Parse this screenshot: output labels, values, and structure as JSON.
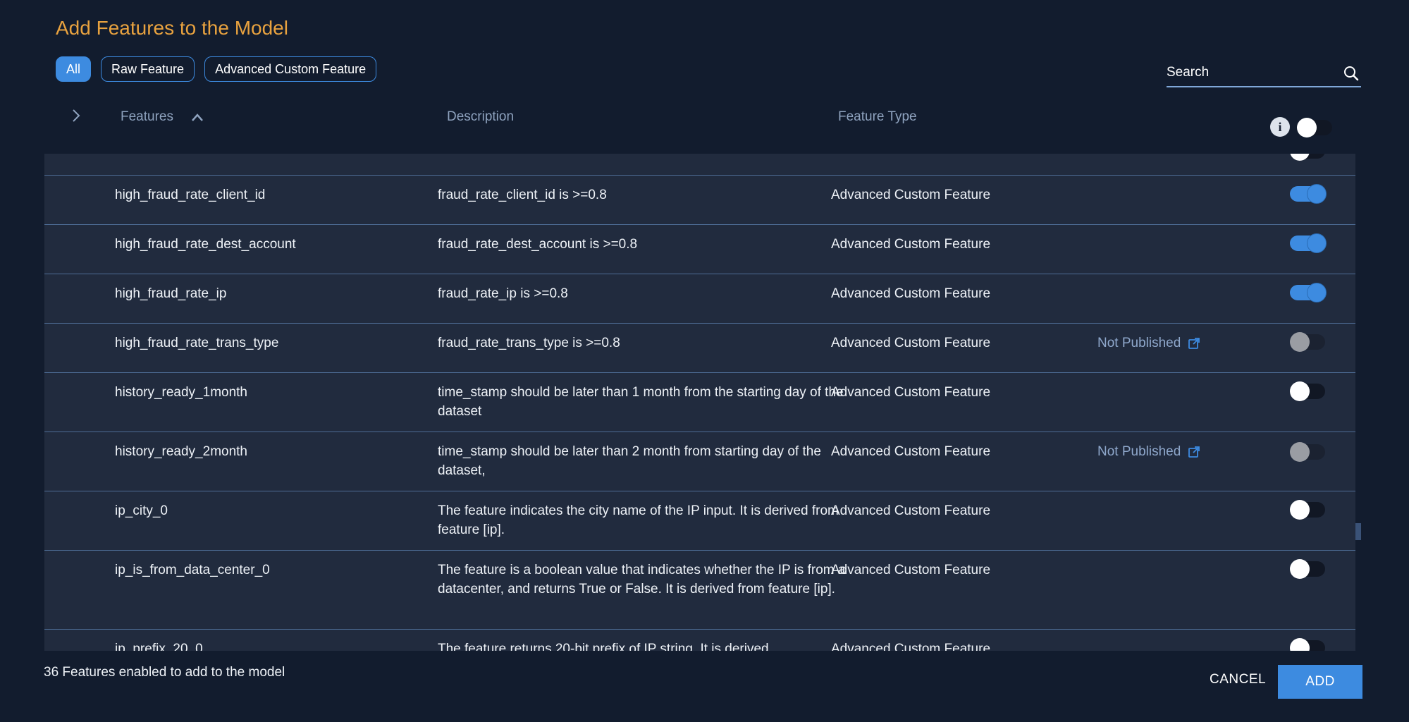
{
  "dialog": {
    "title": "Add Features to the Model"
  },
  "filters": [
    {
      "label": "All",
      "active": true
    },
    {
      "label": "Raw Feature",
      "active": false
    },
    {
      "label": "Advanced Custom Feature",
      "active": false
    }
  ],
  "search": {
    "placeholder": "Search"
  },
  "table": {
    "headers": {
      "features": "Features",
      "description": "Description",
      "feature_type": "Feature Type"
    },
    "rows": [
      {
        "name": "high_fraud_rate_client_id",
        "description": "fraud_rate_client_id is >=0.8",
        "type": "Advanced Custom Feature",
        "status": "",
        "toggle": "on"
      },
      {
        "name": "high_fraud_rate_dest_account",
        "description": "fraud_rate_dest_account is >=0.8",
        "type": "Advanced Custom Feature",
        "status": "",
        "toggle": "on"
      },
      {
        "name": "high_fraud_rate_ip",
        "description": "fraud_rate_ip is >=0.8",
        "type": "Advanced Custom Feature",
        "status": "",
        "toggle": "on"
      },
      {
        "name": "high_fraud_rate_trans_type",
        "description": "fraud_rate_trans_type is >=0.8",
        "type": "Advanced Custom Feature",
        "status": "Not Published",
        "toggle": "disabled"
      },
      {
        "name": "history_ready_1month",
        "description": "time_stamp should be later than 1 month from the starting day of the dataset",
        "type": "Advanced Custom Feature",
        "status": "",
        "toggle": "off"
      },
      {
        "name": "history_ready_2month",
        "description": "time_stamp should be later than 2 month from starting day of the dataset,",
        "type": "Advanced Custom Feature",
        "status": "Not Published",
        "toggle": "disabled"
      },
      {
        "name": "ip_city_0",
        "description": "The feature indicates the city name of the IP input. It is derived from feature [ip].",
        "type": "Advanced Custom Feature",
        "status": "",
        "toggle": "off"
      },
      {
        "name": "ip_is_from_data_center_0",
        "description": "The feature is a boolean value that indicates whether the IP is from a datacenter, and returns True or False. It is derived from feature [ip].",
        "type": "Advanced Custom Feature",
        "status": "",
        "toggle": "off"
      },
      {
        "name": "ip_prefix_20_0",
        "description": "The feature returns 20-bit prefix of IP string. It is derived",
        "type": "Advanced Custom Feature",
        "status": "",
        "toggle": "off"
      }
    ]
  },
  "footer": {
    "count_text": "36 Features enabled to add to the model",
    "cancel_label": "CANCEL",
    "add_label": "ADD"
  },
  "colors": {
    "accent": "#3d8be0",
    "title": "#e8a23f",
    "background": "#121c2e",
    "row_background": "#212b3e"
  }
}
